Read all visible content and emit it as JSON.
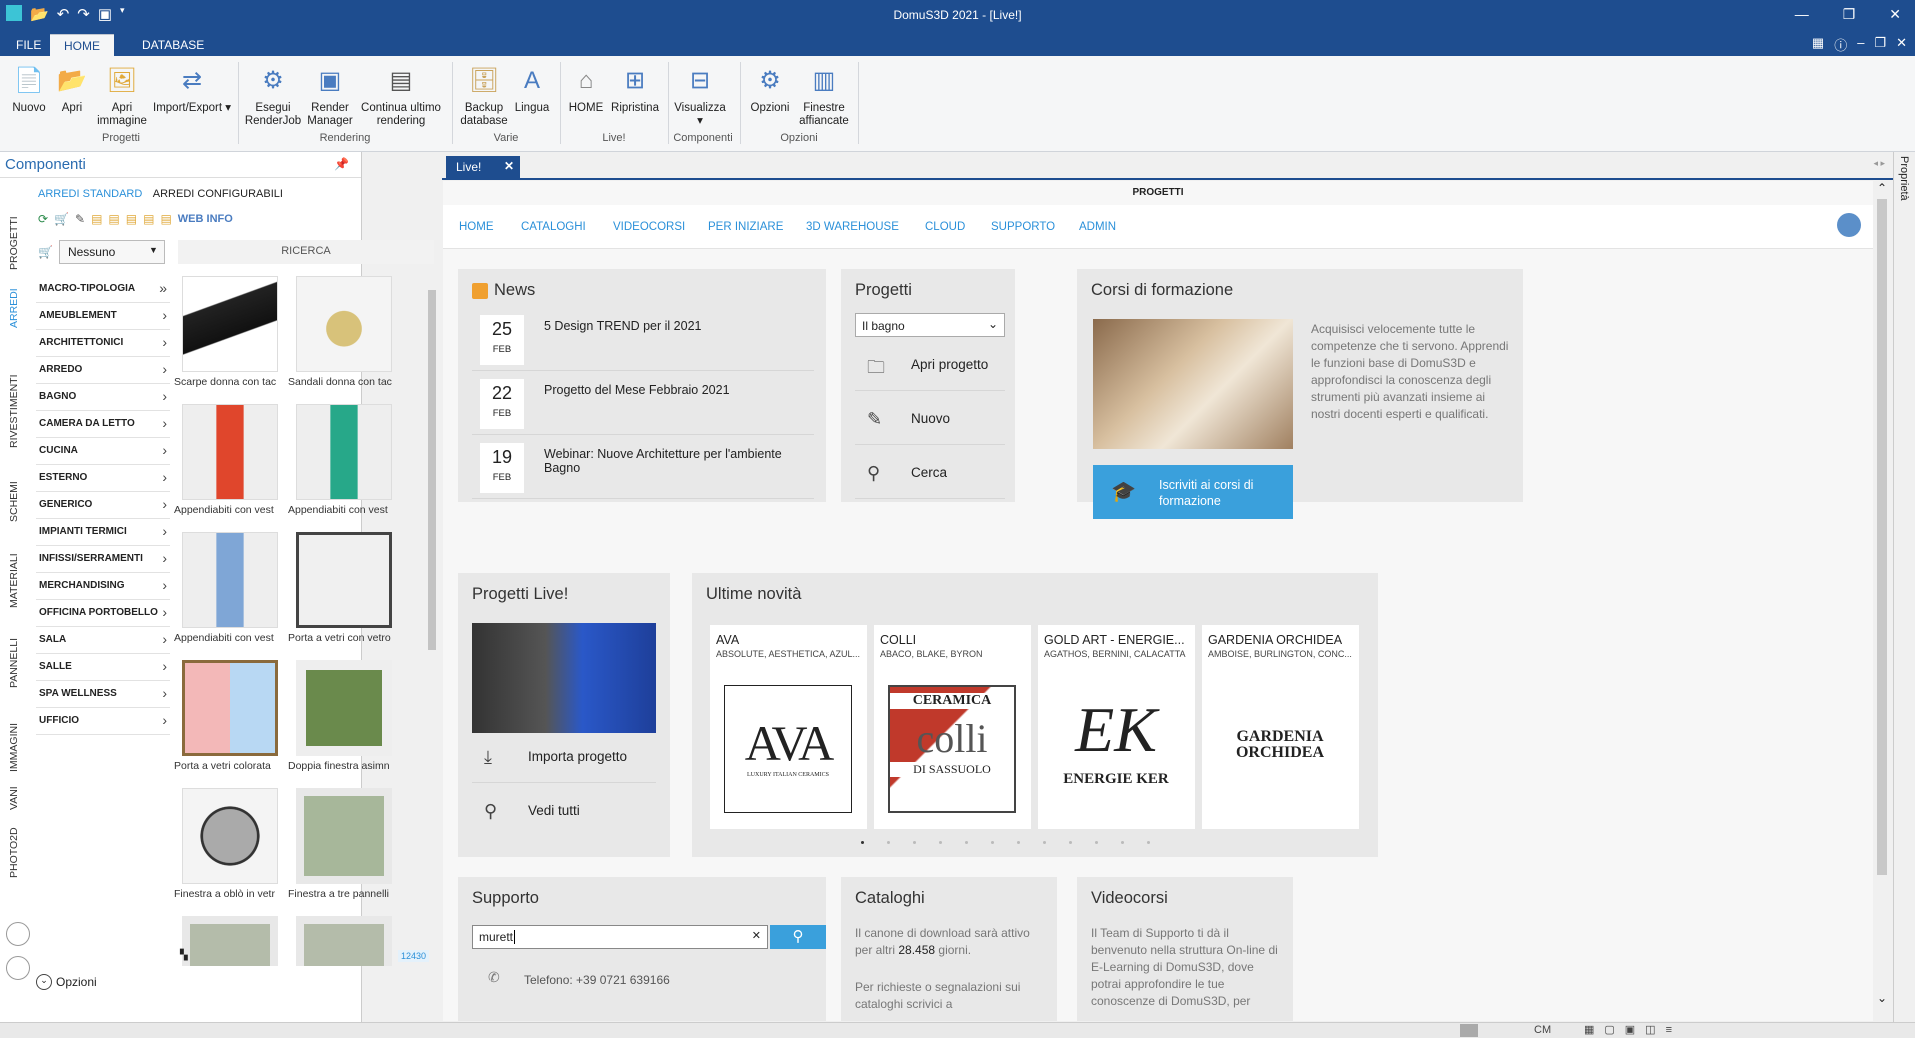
{
  "titlebar": {
    "title": "DomuS3D 2021 - [Live!]"
  },
  "menu": {
    "tabs": [
      "FILE",
      "HOME",
      "DATABASE"
    ]
  },
  "ribbon": {
    "buttons": [
      {
        "label": "Nuovo",
        "icon": "new-file-icon"
      },
      {
        "label": "Apri",
        "icon": "open-folder-icon"
      },
      {
        "label": "Apri immagine",
        "icon": "open-image-icon"
      },
      {
        "label": "Import/Export",
        "icon": "import-export-icon"
      },
      {
        "label": "Esegui RenderJob",
        "icon": "render-job-icon"
      },
      {
        "label": "Render Manager",
        "icon": "render-manager-icon"
      },
      {
        "label": "Continua ultimo rendering",
        "icon": "continue-render-icon"
      },
      {
        "label": "Backup database",
        "icon": "database-backup-icon"
      },
      {
        "label": "Lingua",
        "icon": "language-icon"
      },
      {
        "label": "HOME",
        "icon": "home-icon"
      },
      {
        "label": "Ripristina",
        "icon": "restore-icon"
      },
      {
        "label": "Visualizza",
        "icon": "view-icon"
      },
      {
        "label": "Opzioni",
        "icon": "options-icon"
      },
      {
        "label": "Finestre affiancate",
        "icon": "tile-windows-icon"
      }
    ],
    "groups": [
      "Progetti",
      "Rendering",
      "Varie",
      "Live!",
      "Componenti",
      "Opzioni"
    ]
  },
  "left": {
    "title": "Componenti",
    "vtabs": [
      "PROGETTI",
      "ARREDI",
      "RIVESTIMENTI",
      "SCHEMI",
      "MATERIALI",
      "PANNELLI",
      "IMMAGINI",
      "VANI",
      "PHOTO2D"
    ],
    "subtabs": [
      "ARREDI STANDARD",
      "ARREDI CONFIGURABILI"
    ],
    "web_info": "WEB INFO",
    "filter_value": "Nessuno",
    "search_label": "RICERCA",
    "categories": [
      "MACRO-TIPOLOGIA",
      "AMEUBLEMENT",
      "ARCHITETTONICI",
      "ARREDO",
      "BAGNO",
      "CAMERA DA LETTO",
      "CUCINA",
      "ESTERNO",
      "GENERICO",
      "IMPIANTI TERMICI",
      "INFISSI/SERRAMENTI",
      "MERCHANDISING",
      "OFFICINA PORTOBELLO",
      "SALA",
      "SALLE",
      "SPA WELLNESS",
      "UFFICIO"
    ],
    "items": [
      "Scarpe donna con tac",
      "Sandali donna con tac",
      "Appendiabiti con vest",
      "Appendiabiti con vest",
      "Appendiabiti con vest",
      "Porta a vetri con vetro",
      "Porta a vetri colorata",
      "Doppia finestra asimn",
      "Finestra a oblò in vetr",
      "Finestra a tre pannelli"
    ],
    "count": "12430",
    "options": "Opzioni"
  },
  "doc": {
    "tab": "Live!",
    "page_title": "PROGETTI"
  },
  "nav": [
    "HOME",
    "CATALOGHI",
    "VIDEOCORSI",
    "PER INIZIARE",
    "3D WAREHOUSE",
    "CLOUD",
    "SUPPORTO",
    "ADMIN"
  ],
  "news": {
    "title": "News",
    "items": [
      {
        "day": "25",
        "month": "FEB",
        "text": "5 Design TREND per il 2021"
      },
      {
        "day": "22",
        "month": "FEB",
        "text": "Progetto del Mese Febbraio 2021"
      },
      {
        "day": "19",
        "month": "FEB",
        "text": "Webinar: Nuove Architetture per l'ambiente Bagno"
      }
    ]
  },
  "progetti": {
    "title": "Progetti",
    "select": "Il bagno",
    "actions": [
      "Apri progetto",
      "Nuovo",
      "Cerca"
    ]
  },
  "corsi": {
    "title": "Corsi di formazione",
    "text": "Acquisisci velocemente tutte le competenze che ti servono. Apprendi le funzioni base di DomuS3D e approfondisci la conoscenza degli strumenti più avanzati insieme ai nostri docenti esperti e qualificati.",
    "button": "Iscriviti ai corsi di formazione"
  },
  "live": {
    "title": "Progetti Live!",
    "actions": [
      "Importa progetto",
      "Vedi tutti"
    ]
  },
  "novita": {
    "title": "Ultime novità",
    "brands": [
      {
        "name": "AVA",
        "sub": "ABSOLUTE, AESTHETICA, AZUL...",
        "logo": "AVA",
        "logo_sub": "LUXURY ITALIAN CERAMICS"
      },
      {
        "name": "COLLI",
        "sub": "ABACO, BLAKE, BYRON",
        "logo": "CERAMICA",
        "logo_sub": "DI SASSUOLO",
        "logo_mid": "colli"
      },
      {
        "name": "GOLD ART - ENERGIE...",
        "sub": "AGATHOS, BERNINI, CALACATTA",
        "logo": "EK",
        "logo_sub": "ENERGIE KER"
      },
      {
        "name": "GARDENIA ORCHIDEA",
        "sub": "AMBOISE, BURLINGTON, CONC...",
        "logo": "GARDENIA",
        "logo_sub": "ORCHIDEA"
      }
    ]
  },
  "supporto": {
    "title": "Supporto",
    "search_value": "murett",
    "phone": "Telefono: +39 0721 639166"
  },
  "cataloghi": {
    "title": "Cataloghi",
    "text1": "Il canone di download sarà attivo per altri",
    "days": "28.458",
    "text1b": "giorni.",
    "text2": "Per richieste o segnalazioni sui cataloghi scrivici a"
  },
  "videocorsi": {
    "title": "Videocorsi",
    "text": "Il Team di Supporto ti dà il benvenuto nella struttura On-line di E-Learning di DomuS3D, dove potrai approfondire le tue conoscenze di DomuS3D, per"
  },
  "status": {
    "unit": "CM"
  },
  "right": {
    "label": "Proprietà"
  },
  "colors": {
    "titlebar": "#1e4d8f",
    "accent": "#2b90d9",
    "button": "#3aa0dc"
  }
}
